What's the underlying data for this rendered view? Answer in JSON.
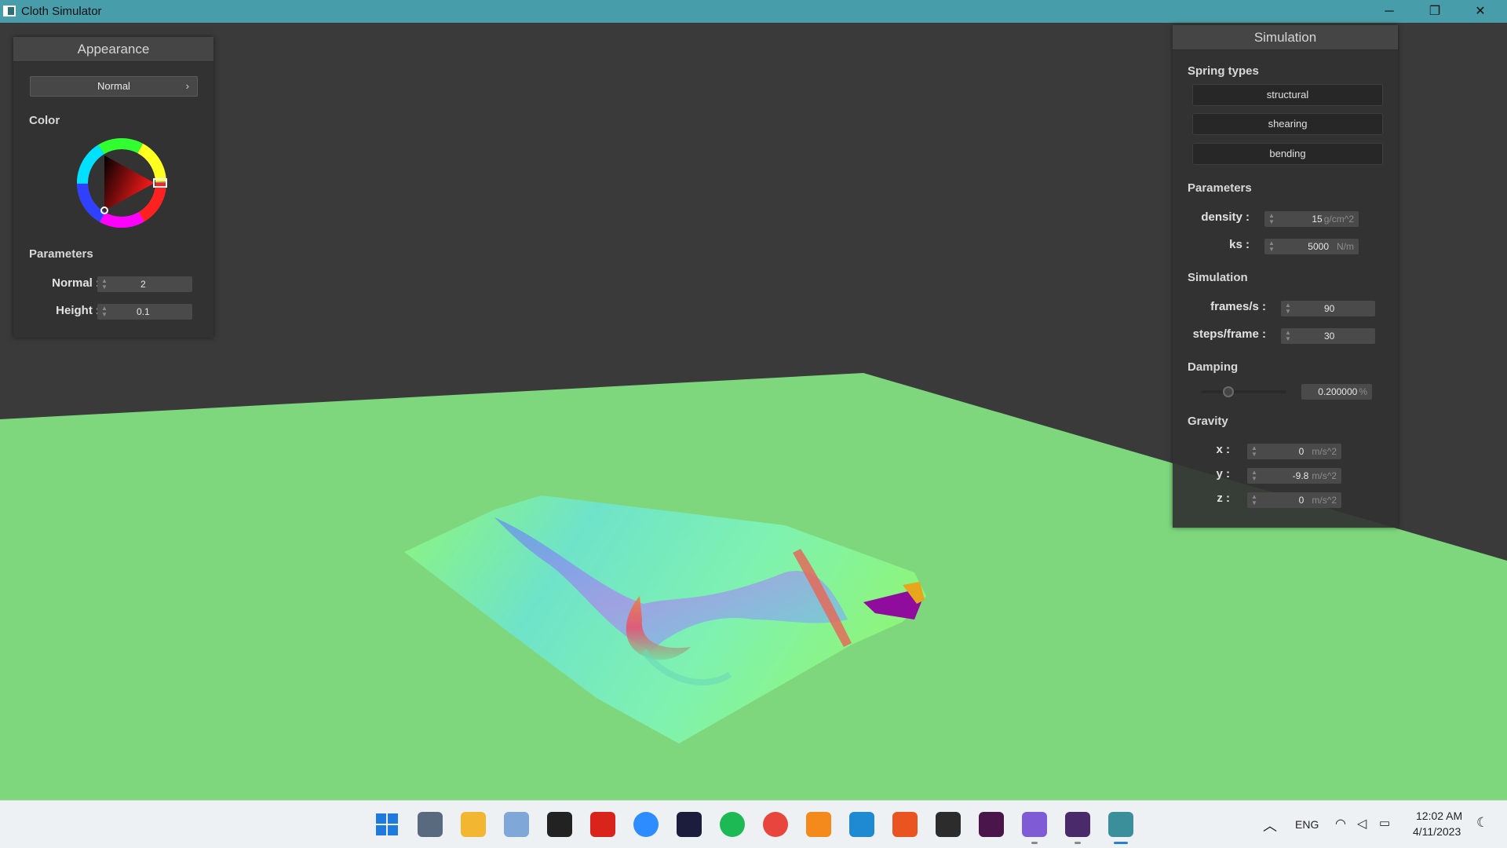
{
  "window": {
    "title": "Cloth Simulator",
    "controls": {
      "minimize": "─",
      "restore": "❐",
      "close": "✕"
    }
  },
  "appearance_panel": {
    "title": "Appearance",
    "shading_mode": "Normal",
    "color_label": "Color",
    "parameters_label": "Parameters",
    "normal_label": "Normal :",
    "normal_value": "2",
    "height_label": "Height :",
    "height_value": "0.1",
    "selected_color": "#ff1a1a"
  },
  "simulation_panel": {
    "title": "Simulation",
    "spring_types_label": "Spring types",
    "spring_buttons": [
      "structural",
      "shearing",
      "bending"
    ],
    "parameters_label": "Parameters",
    "density_label": "density :",
    "density_value": "15",
    "density_unit": "g/cm^2",
    "ks_label": "ks :",
    "ks_value": "5000",
    "ks_unit": "N/m",
    "simulation_label": "Simulation",
    "fps_label": "frames/s :",
    "fps_value": "90",
    "steps_label": "steps/frame :",
    "steps_value": "30",
    "damping_label": "Damping",
    "damping_value": "0.200000",
    "damping_unit": "%",
    "damping_fraction": 0.2,
    "gravity_label": "Gravity",
    "gx_label": "x :",
    "gx_value": "0",
    "gy_label": "y :",
    "gy_value": "-9.8",
    "gz_label": "z :",
    "gz_value": "0",
    "gravity_unit": "m/s^2"
  },
  "taskbar": {
    "apps": [
      {
        "name": "start-icon",
        "color": "#1f7ae0"
      },
      {
        "name": "calculator-icon",
        "color": "#5a6a7e"
      },
      {
        "name": "file-explorer-icon",
        "color": "#f2b630"
      },
      {
        "name": "resource-monitor-icon",
        "color": "#7fa7d8"
      },
      {
        "name": "inkscape-icon",
        "color": "#222222"
      },
      {
        "name": "acrobat-icon",
        "color": "#d9241c"
      },
      {
        "name": "zoom-icon",
        "color": "#2d8cff"
      },
      {
        "name": "intellij-icon",
        "color": "#1c1c3c"
      },
      {
        "name": "spotify-icon",
        "color": "#1db954"
      },
      {
        "name": "chrome-icon",
        "color": "#e8453c"
      },
      {
        "name": "sublime-icon",
        "color": "#f48a1c"
      },
      {
        "name": "vscode-icon",
        "color": "#1f8ad2"
      },
      {
        "name": "ubuntu-icon",
        "color": "#e95420"
      },
      {
        "name": "terminal-icon",
        "color": "#2c2c2c"
      },
      {
        "name": "slack-icon",
        "color": "#4a154b"
      },
      {
        "name": "visual-studio-icon",
        "color": "#7f5bd5"
      },
      {
        "name": "wsl-terminal-icon",
        "color": "#4a2a6a"
      },
      {
        "name": "cloth-simulator-icon",
        "color": "#3a8f9a"
      }
    ],
    "language": "ENG",
    "time": "12:02 AM",
    "date": "4/11/2023"
  }
}
